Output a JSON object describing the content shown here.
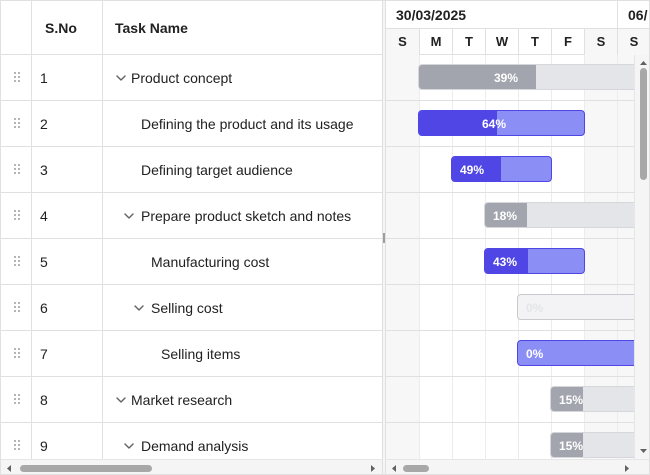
{
  "columns": {
    "sno": "S.No",
    "task_name": "Task Name"
  },
  "timeline": {
    "weeks": [
      "30/03/2025",
      "06/"
    ],
    "days": [
      "S",
      "M",
      "T",
      "W",
      "T",
      "F",
      "S",
      "S"
    ]
  },
  "tasks": [
    {
      "sno": "1",
      "name": "Product concept",
      "expander": "chevron-down-icon",
      "progress": "39%",
      "type": "parent"
    },
    {
      "sno": "2",
      "name": "Defining the product and its usage",
      "progress": "64%",
      "type": "child"
    },
    {
      "sno": "3",
      "name": "Defining target audience",
      "progress": "49%",
      "type": "child"
    },
    {
      "sno": "4",
      "name": "Prepare product sketch and notes",
      "expander": "chevron-down-icon",
      "progress": "18%",
      "type": "parent"
    },
    {
      "sno": "5",
      "name": "Manufacturing cost",
      "progress": "43%",
      "type": "child"
    },
    {
      "sno": "6",
      "name": "Selling cost",
      "expander": "chevron-down-icon",
      "progress": "0%",
      "type": "parent"
    },
    {
      "sno": "7",
      "name": "Selling items",
      "progress": "0%",
      "type": "child"
    },
    {
      "sno": "8",
      "name": "Market research",
      "expander": "chevron-down-icon",
      "progress": "15%",
      "type": "parent"
    },
    {
      "sno": "9",
      "name": "Demand analysis",
      "expander": "chevron-down-icon",
      "progress": "15%",
      "type": "parent"
    }
  ],
  "colors": {
    "child_fill": "#4f46e5",
    "child_bar": "#8b8ef5",
    "parent_fill": "#a2a5ad",
    "parent_bar": "#e4e5e8",
    "weekend": "#f7f7f8"
  }
}
